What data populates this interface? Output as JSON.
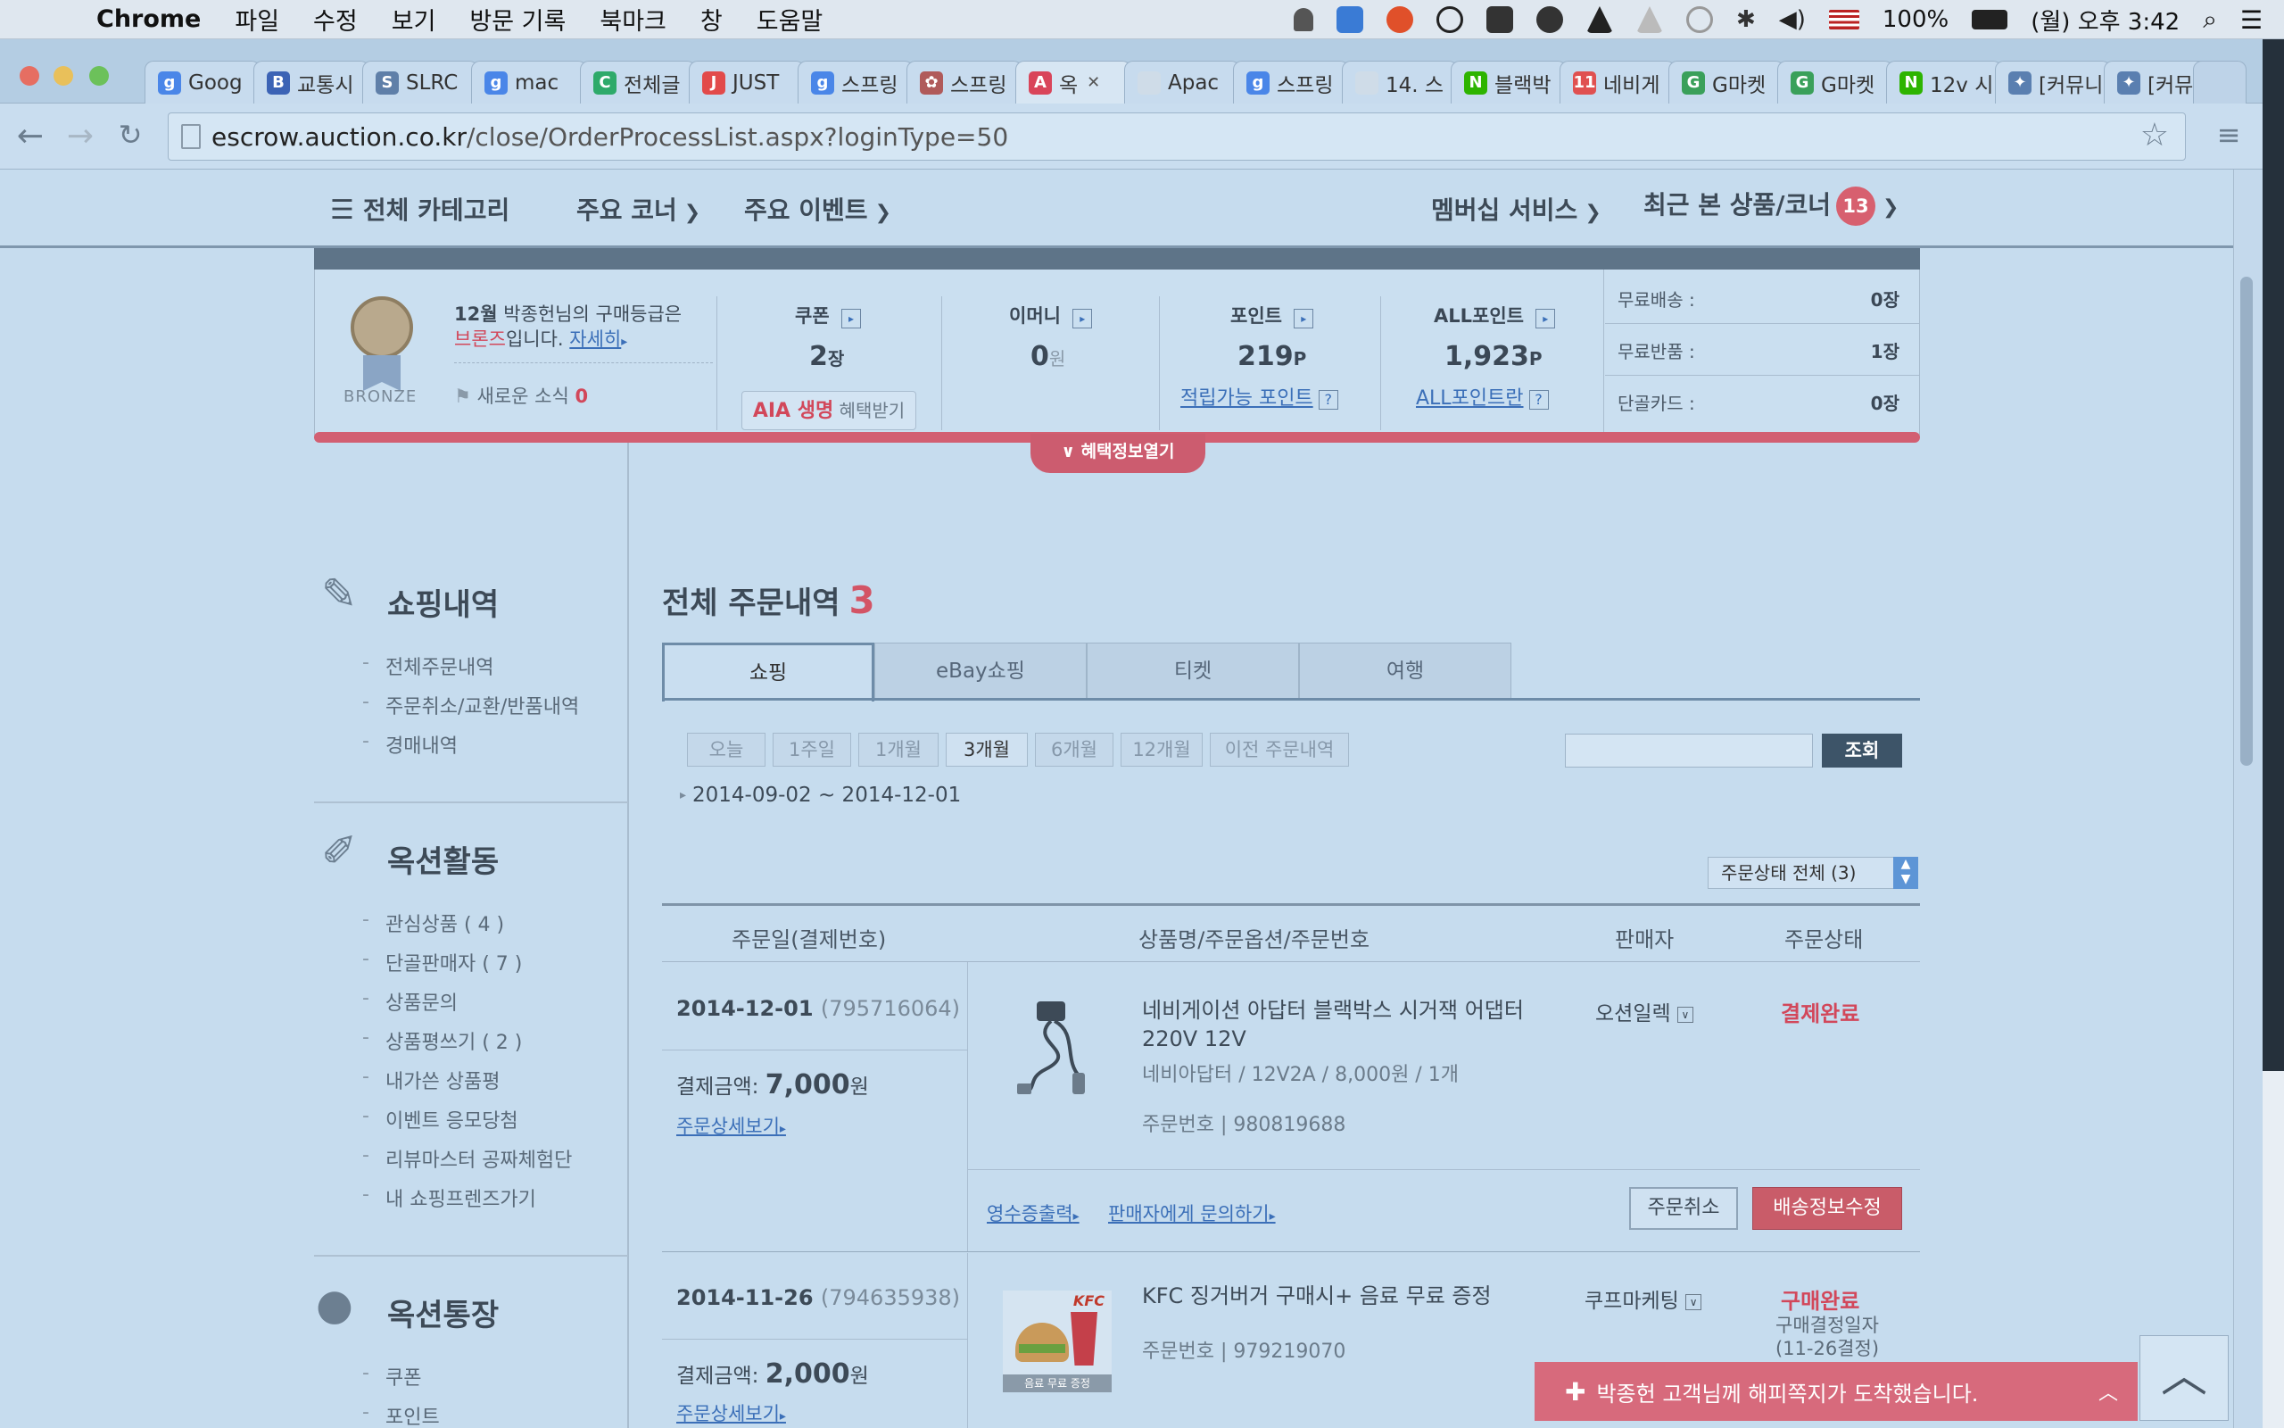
{
  "menubar": {
    "app": "Chrome",
    "items": [
      "파일",
      "수정",
      "보기",
      "방문 기록",
      "북마크",
      "창",
      "도움말"
    ],
    "battery": "100%",
    "clock": "(월) 오후 3:42"
  },
  "tabs": [
    {
      "label": "Goog",
      "color": "#4a86e8",
      "glyph": "g"
    },
    {
      "label": "교통시",
      "color": "#3c63b5",
      "glyph": "B"
    },
    {
      "label": "SLRC",
      "color": "#5f7fa8",
      "glyph": "S"
    },
    {
      "label": "mac",
      "color": "#4a86e8",
      "glyph": "g"
    },
    {
      "label": "전체글",
      "color": "#2eaa6a",
      "glyph": "C"
    },
    {
      "label": "JUST",
      "color": "#e24a4a",
      "glyph": "J"
    },
    {
      "label": "스프링",
      "color": "#4a86e8",
      "glyph": "g"
    },
    {
      "label": "스프링",
      "color": "#b05a5a",
      "glyph": "✿"
    },
    {
      "label": "옥",
      "color": "#d9455a",
      "glyph": "A"
    },
    {
      "label": "Apac",
      "color": "#cfdce8",
      "glyph": ""
    },
    {
      "label": "스프링",
      "color": "#4a86e8",
      "glyph": "g"
    },
    {
      "label": "14. 스",
      "color": "#cfdce8",
      "glyph": ""
    },
    {
      "label": "블랙박",
      "color": "#2db400",
      "glyph": "N"
    },
    {
      "label": "네비게",
      "color": "#e05050",
      "glyph": "11"
    },
    {
      "label": "G마켓",
      "color": "#3aa05a",
      "glyph": "G"
    },
    {
      "label": "G마켓",
      "color": "#3aa05a",
      "glyph": "G"
    },
    {
      "label": "12v 시",
      "color": "#2db400",
      "glyph": "N"
    },
    {
      "label": "[커뮤니",
      "color": "#5a7fb0",
      "glyph": "✦"
    },
    {
      "label": "[커뮤니",
      "color": "#5a7fb0",
      "glyph": "✦"
    }
  ],
  "address": {
    "host": "escrow.auction.co.kr",
    "path": "/close/OrderProcessList.aspx?loginType=50"
  },
  "header": {
    "all_categories": "전체 카테고리",
    "main_corner": "주요 코너",
    "main_event": "주요 이벤트",
    "membership": "멤버십 서비스",
    "recent": "최근 본 상품/코너",
    "recent_count": "13"
  },
  "benefit": {
    "grade_line1_a": "12월",
    "grade_line1_b": " 박종헌님의 구매등급은",
    "grade_name": "브론즈",
    "grade_line2": "입니다.",
    "detail_link": "자세히",
    "medal_label": "BRONZE",
    "news_label": "새로운 소식",
    "news_count": "0",
    "coupon_title": "쿠폰",
    "coupon_val": "2",
    "coupon_unit": "장",
    "emoney_title": "이머니",
    "emoney_val": "0",
    "emoney_unit": "원",
    "point_title": "포인트",
    "point_val": "219",
    "point_unit": "P",
    "point_link": "적립가능 포인트",
    "allpoint_title": "ALL포인트",
    "allpoint_val": "1,923",
    "allpoint_unit": "P",
    "allpoint_link": "ALL포인트란",
    "aia_a": "AIA 생명",
    "aia_b": " 혜택받기",
    "free_ship": "무료배송 :",
    "free_ship_val": "0장",
    "free_return": "무료반품 :",
    "free_return_val": "1장",
    "regular_card": "단골카드 :",
    "regular_card_val": "0장",
    "open_button": "혜택정보열기"
  },
  "sidebar": {
    "shopping_title": "쇼핑내역",
    "shopping_items": [
      "전체주문내역",
      "주문취소/교환/반품내역",
      "경매내역"
    ],
    "auction_title": "옥션활동",
    "auction_items": [
      "관심상품 ( 4 )",
      "단골판매자 ( 7 )",
      "상품문의",
      "상품평쓰기 ( 2 )",
      "내가쓴 상품평",
      "이벤트 응모당첨",
      "리뷰마스터 공짜체험단",
      "내 쇼핑프렌즈가기"
    ],
    "bank_title": "옥션통장",
    "bank_items": [
      "쿠폰",
      "포인트"
    ]
  },
  "main": {
    "title": "전체 주문내역",
    "count": "3",
    "tabs": [
      "쇼핑",
      "eBay쇼핑",
      "티켓",
      "여행"
    ],
    "periods": [
      "오늘",
      "1주일",
      "1개월",
      "3개월",
      "6개월",
      "12개월",
      "이전 주문내역"
    ],
    "selected_period": "3개월",
    "search_button": "조회",
    "date_range": "2014-09-02 ~ 2014-12-01",
    "status_select": "주문상태 전체 (3)",
    "columns": [
      "주문일(결제번호)",
      "상품명/주문옵션/주문번호",
      "판매자",
      "주문상태"
    ]
  },
  "orders": [
    {
      "date": "2014-12-01",
      "pay_no": "(795716064)",
      "amount_label": "결제금액: ",
      "amount": "7,000",
      "amount_unit": "원",
      "detail_link": "주문상세보기",
      "product": "네비게이션 아답터 블랙박스 시거잭 어댑터 220V 12V",
      "option": "네비아답터 / 12V2A / 8,000원 / 1개",
      "order_no": "주문번호 | 980819688",
      "seller": "오션일렉",
      "status": "결제완료",
      "receipt_link": "영수증출력",
      "ask_link": "판매자에게 문의하기",
      "cancel_button": "주문취소",
      "ship_button": "배송정보수정"
    },
    {
      "date": "2014-11-26",
      "pay_no": "(794635938)",
      "amount_label": "결제금액: ",
      "amount": "2,000",
      "amount_unit": "원",
      "detail_link": "주문상세보기",
      "product": "KFC 징거버거 구매시+ 음료 무료 증정",
      "order_no": "주문번호 | 979219070",
      "seller": "쿠프마케팅",
      "status": "구매완료",
      "status_sub": "구매결정일자",
      "status_sub2": "(11-26결정)",
      "thumb_brand": "KFC",
      "thumb_caption": "음료 무료 증정"
    }
  ],
  "toast": {
    "message": "박종헌 고객님께 해피쪽지가 도착했습니다."
  }
}
